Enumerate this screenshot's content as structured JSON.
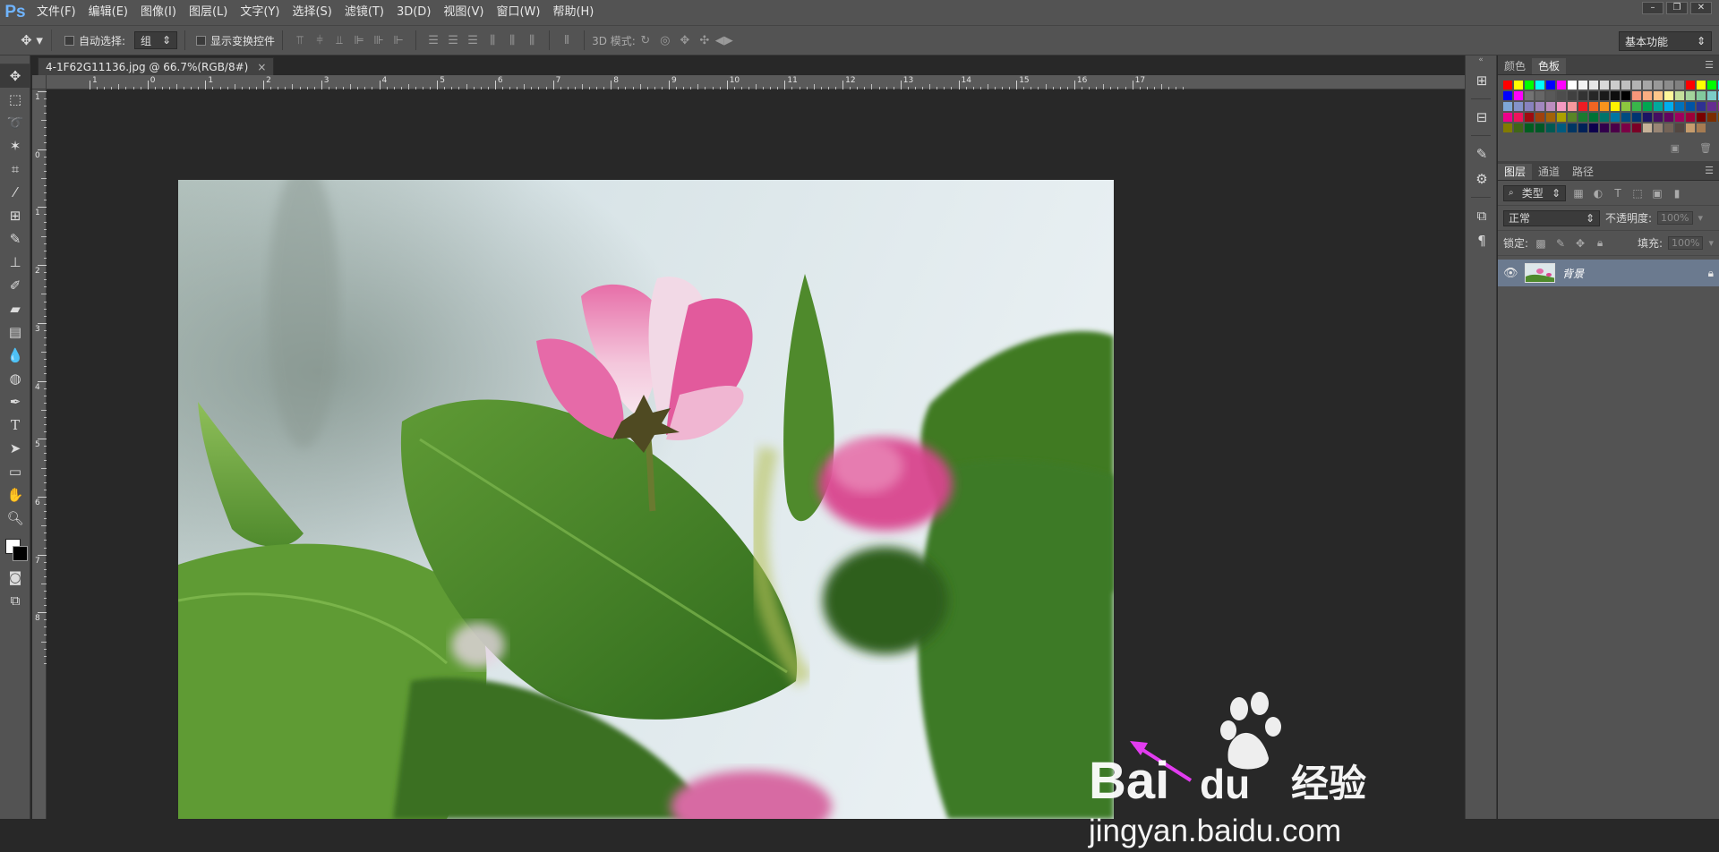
{
  "app": {
    "logo": "Ps"
  },
  "menu": [
    "文件(F)",
    "编辑(E)",
    "图像(I)",
    "图层(L)",
    "文字(Y)",
    "选择(S)",
    "滤镜(T)",
    "3D(D)",
    "视图(V)",
    "窗口(W)",
    "帮助(H)"
  ],
  "options": {
    "auto_select_label": "自动选择:",
    "auto_select_value": "组",
    "show_transform_label": "显示变换控件",
    "mode_3d_label": "3D 模式:",
    "workspace": "基本功能"
  },
  "document": {
    "tab_title": "4-1F62G11136.jpg @ 66.7%(RGB/8#)"
  },
  "ruler": {
    "h_ticks": [
      "1",
      "0",
      "1",
      "2",
      "3",
      "4",
      "5",
      "6",
      "7",
      "8",
      "9",
      "10",
      "11",
      "12",
      "13",
      "14",
      "15",
      "16",
      "17"
    ],
    "v_ticks": [
      "1",
      "0",
      "1",
      "2",
      "3",
      "4",
      "5",
      "6",
      "7",
      "8"
    ]
  },
  "color_panel": {
    "tabs": [
      "颜色",
      "色板"
    ],
    "active_tab": "色板",
    "swatches": [
      "#ff0000",
      "#ffff00",
      "#00ff00",
      "#00ffff",
      "#0000ff",
      "#ff00ff",
      "#ffffff",
      "#f2f2f2",
      "#e6e6e6",
      "#d9d9d9",
      "#cccccc",
      "#bfbfbf",
      "#b3b3b3",
      "#a6a6a6",
      "#999999",
      "#8c8c8c",
      "#808080",
      "#ff0000",
      "#ffff00",
      "#00ff00",
      "#00ffff",
      "#0000ff",
      "#ff00ff",
      "#737373",
      "#666666",
      "#595959",
      "#4d4d4d",
      "#404040",
      "#333333",
      "#262626",
      "#1a1a1a",
      "#0d0d0d",
      "#000000",
      "#f7977a",
      "#f9ad81",
      "#fdc68a",
      "#fff79a",
      "#c4df9b",
      "#a3d39c",
      "#82ca9d",
      "#7bcdc8",
      "#6ecff6",
      "#7ea7d8",
      "#8493ca",
      "#8882be",
      "#a187be",
      "#bc8dbf",
      "#f49ac2",
      "#f6989d",
      "#ed1c24",
      "#f26522",
      "#f7941d",
      "#fff200",
      "#8dc73f",
      "#39b54a",
      "#00a651",
      "#00a99d",
      "#00aeef",
      "#0072bc",
      "#0054a6",
      "#2e3192",
      "#662d91",
      "#92278f",
      "#ec008c",
      "#ed145b",
      "#9e0b0f",
      "#a0410d",
      "#a36209",
      "#aba000",
      "#598527",
      "#1a7b30",
      "#007236",
      "#00746b",
      "#0076a3",
      "#004b80",
      "#003471",
      "#1b1464",
      "#440e62",
      "#630460",
      "#9e005d",
      "#9e0039",
      "#790000",
      "#7b2e00",
      "#7d4900",
      "#827b00",
      "#406618",
      "#005e20",
      "#005826",
      "#005952",
      "#005b7f",
      "#003663",
      "#002157",
      "#0d004c",
      "#32004b",
      "#4b0049",
      "#7b0046",
      "#7a0026",
      "#c7b299",
      "#998675",
      "#736357",
      "#534741",
      "#c69c6d",
      "#a67c52"
    ]
  },
  "layers_panel": {
    "tabs": [
      "图层",
      "通道",
      "路径"
    ],
    "active_tab": "图层",
    "filter_label": "类型",
    "blend_mode": "正常",
    "opacity_label": "不透明度:",
    "opacity_value": "100%",
    "lock_label": "锁定:",
    "fill_label": "填充:",
    "fill_value": "100%",
    "layers": [
      {
        "name": "背景",
        "visible": true,
        "locked": true
      }
    ]
  },
  "watermark": {
    "brand": "Bai",
    "brand2": "du",
    "suffix": "经验",
    "url": "jingyan.baidu.com"
  }
}
